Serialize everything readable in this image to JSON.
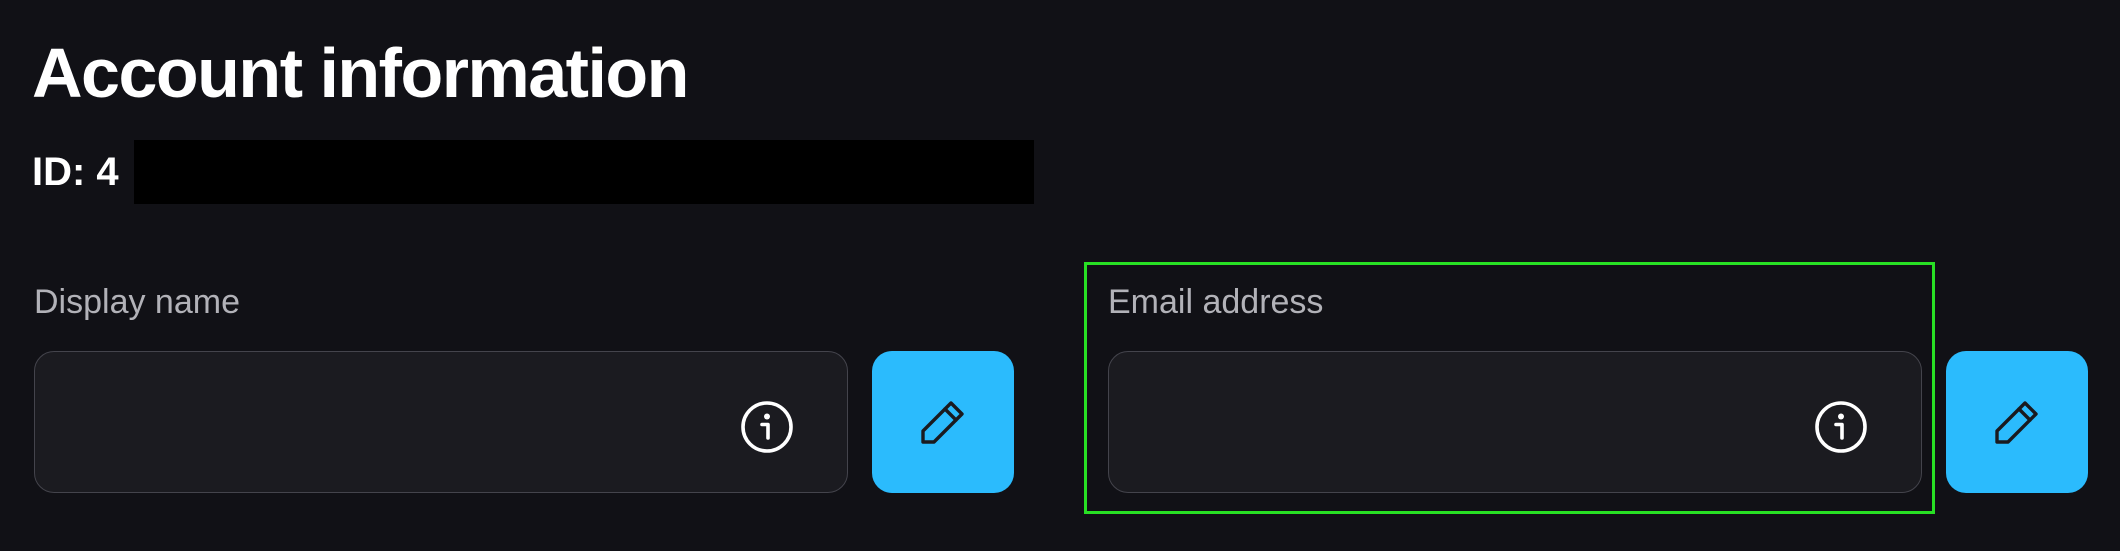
{
  "page": {
    "title": "Account information"
  },
  "account": {
    "id_label": "ID: 4"
  },
  "fields": {
    "display_name": {
      "label": "Display name",
      "value": ""
    },
    "email": {
      "label": "Email address",
      "value": ""
    }
  },
  "icons": {
    "info": "info-icon",
    "edit": "pencil-icon"
  },
  "colors": {
    "background": "#111116",
    "input_background": "#1b1b20",
    "input_border": "#44444c",
    "label_text": "#b2b2b8",
    "accent": "#2bbbfd",
    "focus_outline": "#28e024"
  }
}
